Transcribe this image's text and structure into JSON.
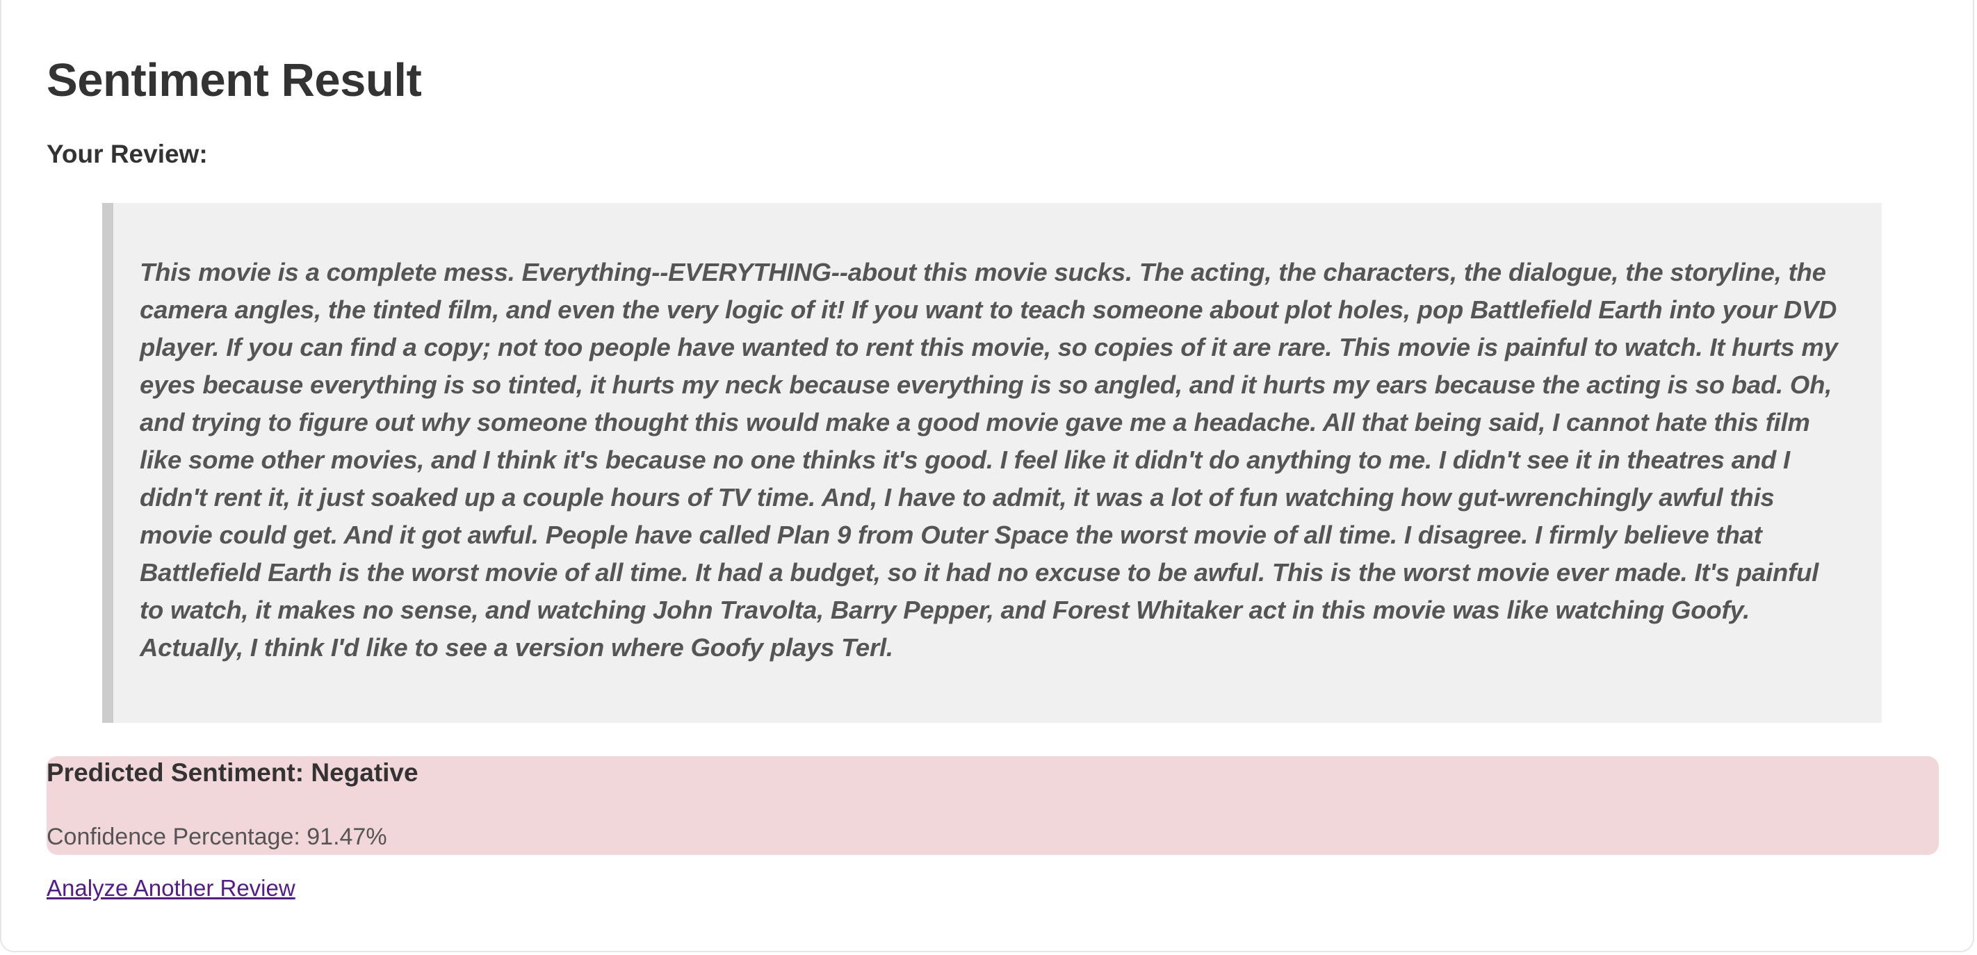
{
  "page": {
    "title": "Sentiment Result",
    "review_label": "Your Review:",
    "review_text": "This movie is a complete mess. Everything--EVERYTHING--about this movie sucks. The acting, the characters, the dialogue, the storyline, the camera angles, the tinted film, and even the very logic of it! If you want to teach someone about plot holes, pop Battlefield Earth into your DVD player. If you can find a copy; not too people have wanted to rent this movie, so copies of it are rare. This movie is painful to watch. It hurts my eyes because everything is so tinted, it hurts my neck because everything is so angled, and it hurts my ears because the acting is so bad. Oh, and trying to figure out why someone thought this would make a good movie gave me a headache. All that being said, I cannot hate this film like some other movies, and I think it's because no one thinks it's good. I feel like it didn't do anything to me. I didn't see it in theatres and I didn't rent it, it just soaked up a couple hours of TV time. And, I have to admit, it was a lot of fun watching how gut-wrenchingly awful this movie could get. And it got awful. People have called Plan 9 from Outer Space the worst movie of all time. I disagree. I firmly believe that Battlefield Earth is the worst movie of all time. It had a budget, so it had no excuse to be awful. This is the worst movie ever made. It's painful to watch, it makes no sense, and watching John Travolta, Barry Pepper, and Forest Whitaker act in this movie was like watching Goofy. Actually, I think I'd like to see a version where Goofy plays Terl."
  },
  "result": {
    "heading": "Predicted Sentiment: Negative",
    "confidence": "Confidence Percentage: 91.47%",
    "background_color": "#f2d7da"
  },
  "actions": {
    "analyze_another_label": "Analyze Another Review",
    "link_color": "#551a8b"
  }
}
